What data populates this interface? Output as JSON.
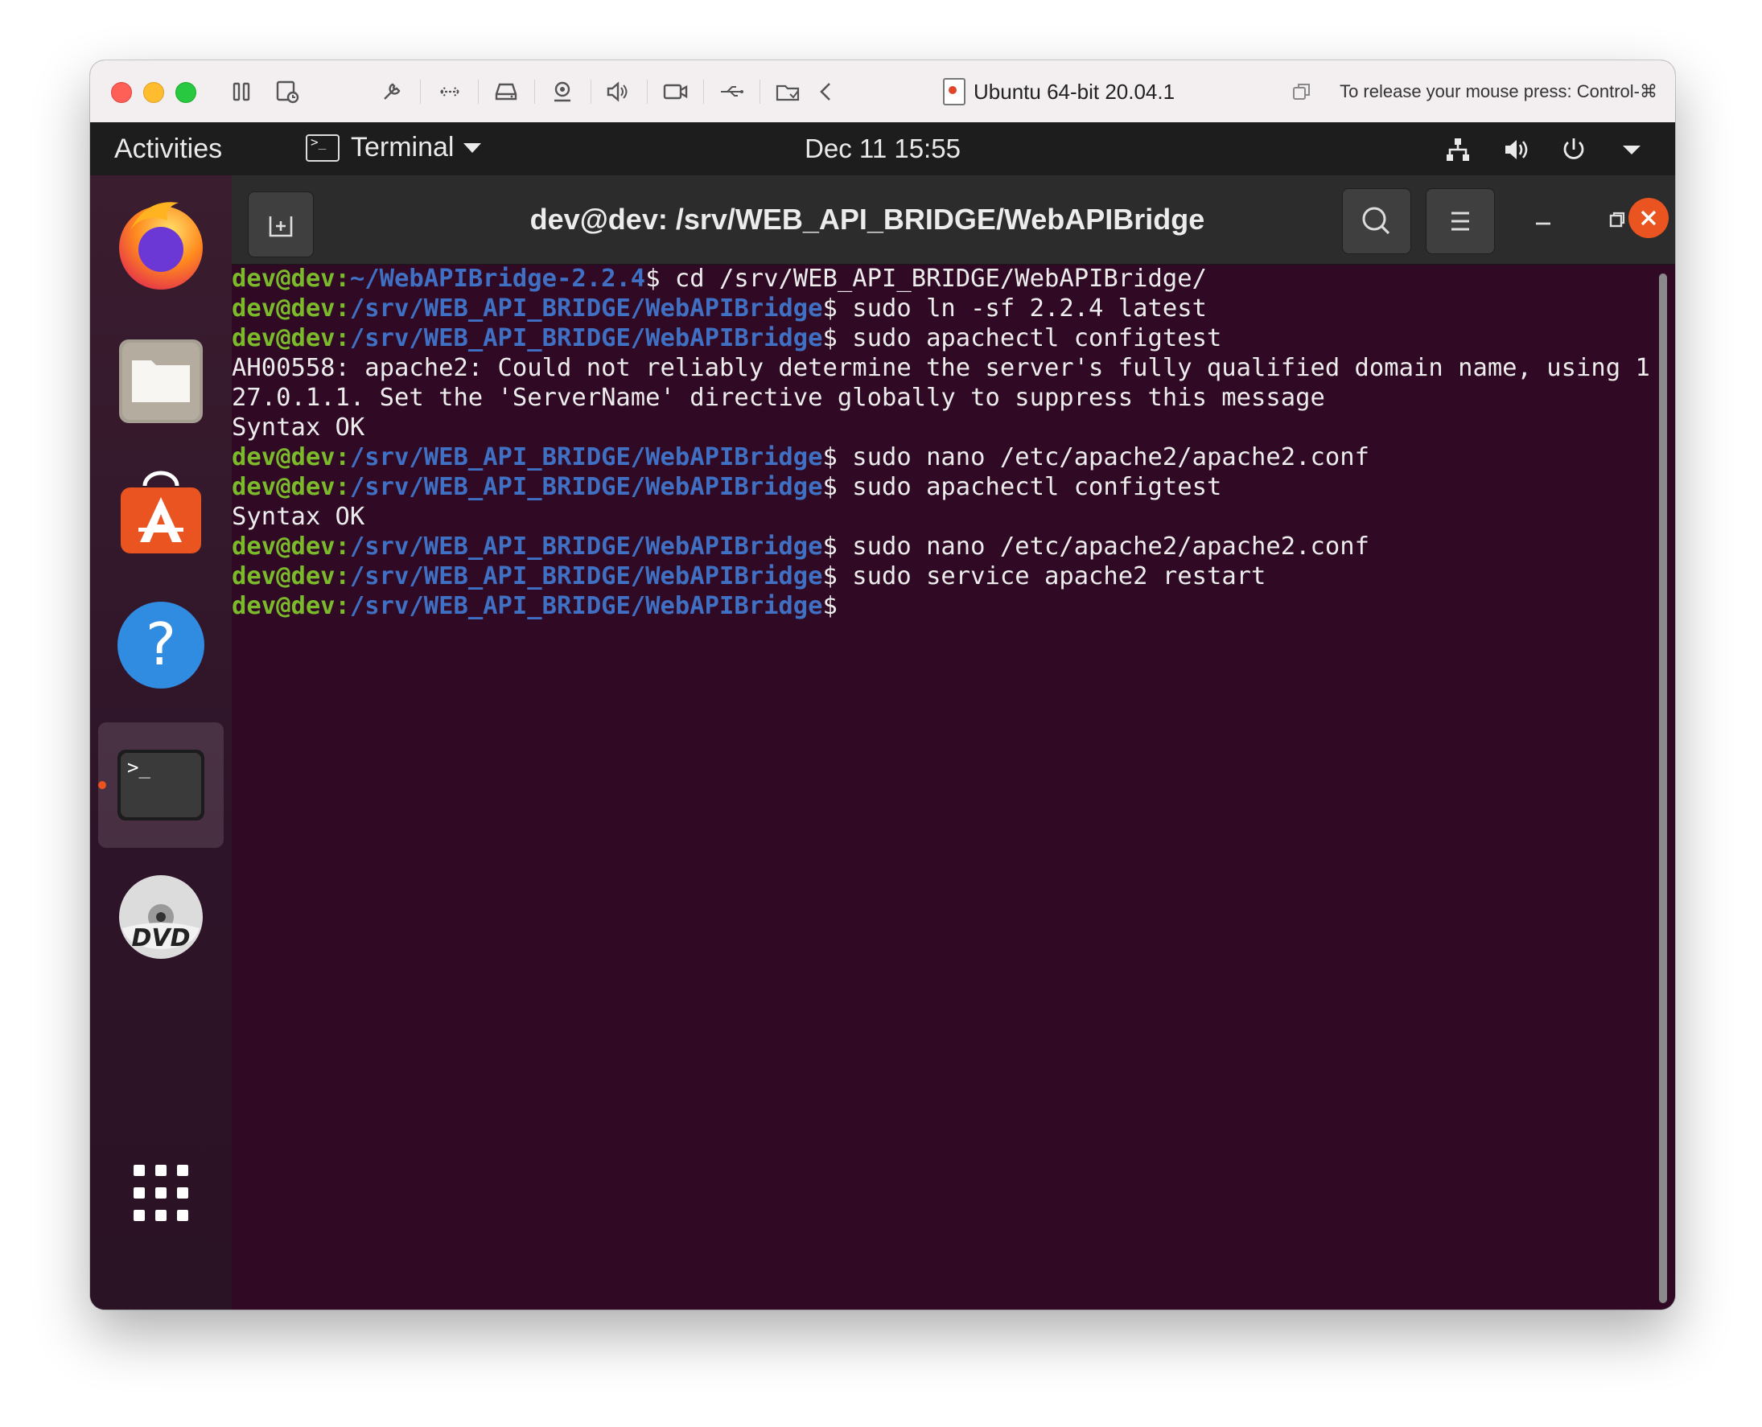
{
  "vm": {
    "title": "Ubuntu 64-bit 20.04.1",
    "release_hint": "To release your mouse press: Control-⌘"
  },
  "topbar": {
    "activities": "Activities",
    "app_name": "Terminal",
    "clock": "Dec 11  15:55"
  },
  "dock": {
    "items": [
      {
        "name": "firefox-icon"
      },
      {
        "name": "files-icon"
      },
      {
        "name": "software-icon"
      },
      {
        "name": "help-icon"
      },
      {
        "name": "terminal-icon",
        "active": true
      },
      {
        "name": "dvd-icon"
      },
      {
        "name": "show-apps-icon"
      }
    ]
  },
  "terminal": {
    "title": "dev@dev: /srv/WEB_API_BRIDGE/WebAPIBridge",
    "lines": [
      {
        "user": "dev@dev",
        "path": "~/WebAPIBridge-2.2.4",
        "cmd": "$ cd /srv/WEB_API_BRIDGE/WebAPIBridge/"
      },
      {
        "user": "dev@dev",
        "path": "/srv/WEB_API_BRIDGE/WebAPIBridge",
        "cmd": "$ sudo ln -sf 2.2.4 latest"
      },
      {
        "user": "dev@dev",
        "path": "/srv/WEB_API_BRIDGE/WebAPIBridge",
        "cmd": "$ sudo apachectl configtest"
      },
      {
        "out": "AH00558: apache2: Could not reliably determine the server's fully qualified domain name, using 127.0.1.1. Set the 'ServerName' directive globally to suppress this message"
      },
      {
        "out": "Syntax OK"
      },
      {
        "user": "dev@dev",
        "path": "/srv/WEB_API_BRIDGE/WebAPIBridge",
        "cmd": "$ sudo nano /etc/apache2/apache2.conf"
      },
      {
        "user": "dev@dev",
        "path": "/srv/WEB_API_BRIDGE/WebAPIBridge",
        "cmd": "$ sudo apachectl configtest"
      },
      {
        "out": "Syntax OK"
      },
      {
        "user": "dev@dev",
        "path": "/srv/WEB_API_BRIDGE/WebAPIBridge",
        "cmd": "$ sudo nano /etc/apache2/apache2.conf"
      },
      {
        "user": "dev@dev",
        "path": "/srv/WEB_API_BRIDGE/WebAPIBridge",
        "cmd": "$ sudo service apache2 restart"
      },
      {
        "user": "dev@dev",
        "path": "/srv/WEB_API_BRIDGE/WebAPIBridge",
        "cmd": "$"
      }
    ]
  },
  "colors": {
    "terminal_bg": "#300a24",
    "prompt_user": "#7bba2a",
    "prompt_path": "#3f70c4",
    "accent": "#e95420"
  }
}
